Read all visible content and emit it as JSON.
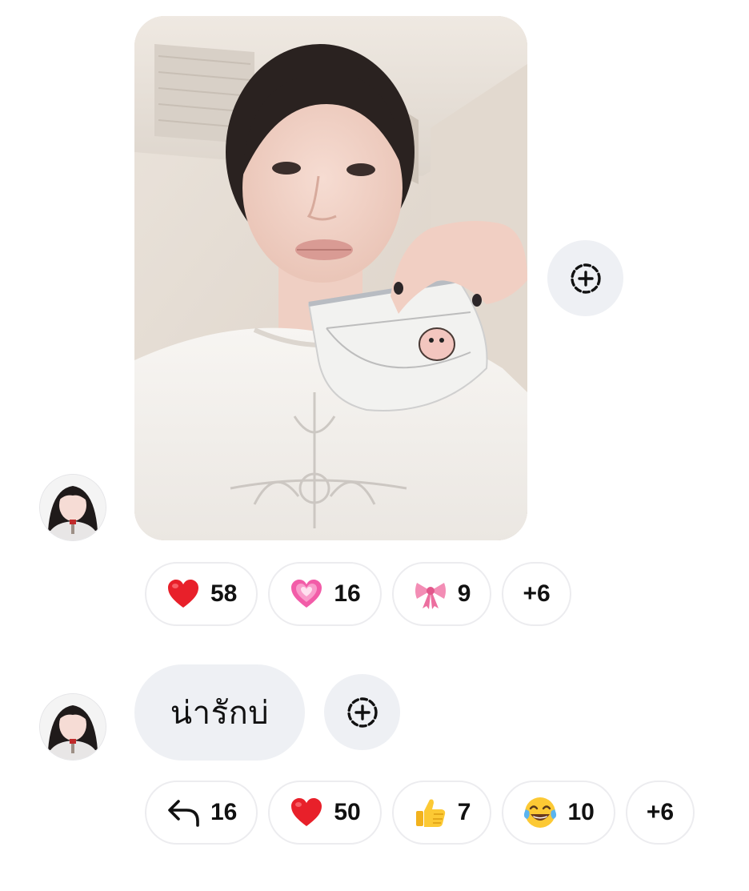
{
  "messages": [
    {
      "type": "photo",
      "sender_avatar": "avatar",
      "reactions": [
        {
          "icon": "red-heart-icon",
          "count": "58"
        },
        {
          "icon": "sparkling-heart-icon",
          "count": "16"
        },
        {
          "icon": "ribbon-bow-icon",
          "count": "9"
        }
      ],
      "more_label": "+6",
      "add_reaction_icon": "add-reaction-icon"
    },
    {
      "type": "text",
      "sender_avatar": "avatar",
      "text": "น่ารักบ่",
      "reactions": [
        {
          "icon": "reply-arrow-icon",
          "count": "16"
        },
        {
          "icon": "red-heart-icon",
          "count": "50"
        },
        {
          "icon": "thumbs-up-icon",
          "count": "7"
        },
        {
          "icon": "tears-of-joy-icon",
          "count": "10"
        }
      ],
      "more_label": "+6",
      "add_reaction_icon": "add-reaction-icon"
    }
  ],
  "colors": {
    "bubble_background": "#eef0f4",
    "pill_border": "#ececef",
    "text": "#111111"
  }
}
